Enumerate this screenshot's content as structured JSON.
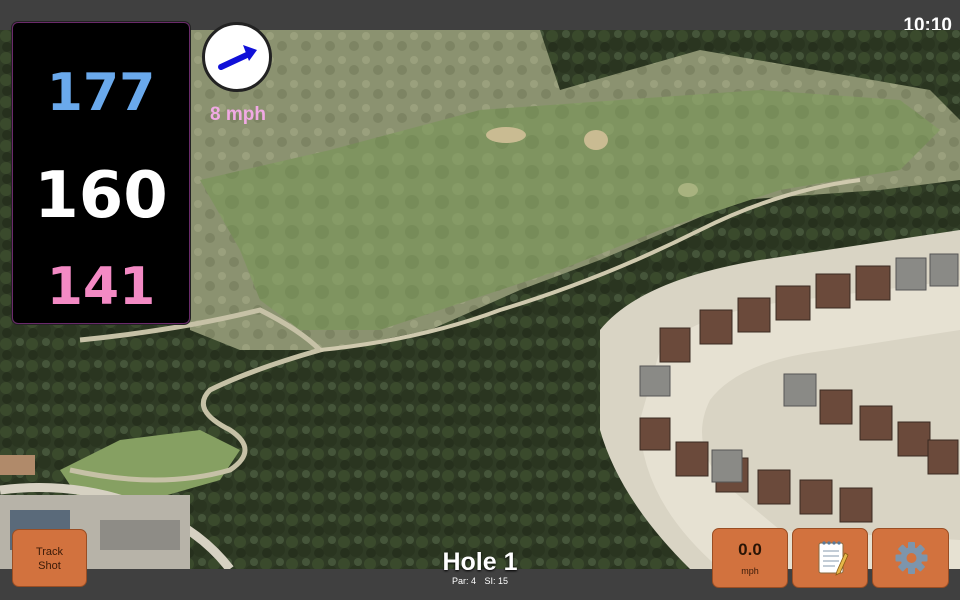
{
  "status_bar": {
    "time": "10:10"
  },
  "distances": {
    "back": "177",
    "middle": "160",
    "front": "141"
  },
  "wind": {
    "speed_label": "8 mph",
    "direction_icon": "arrow-right-icon"
  },
  "hole": {
    "title": "Hole 1",
    "par_label": "Par: 4",
    "si_label": "SI: 15"
  },
  "buttons": {
    "track_shot_line1": "Track",
    "track_shot_line2": "Shot",
    "speed_value": "0.0",
    "speed_unit": "mph",
    "notes_icon": "notepad-icon",
    "settings_icon": "gear-icon"
  },
  "colors": {
    "back_distance": "#6aa9ec",
    "middle_distance": "#ffffff",
    "front_distance": "#f38ac4",
    "button_fill": "#d2723e",
    "wind_label": "#f1a9e4"
  }
}
